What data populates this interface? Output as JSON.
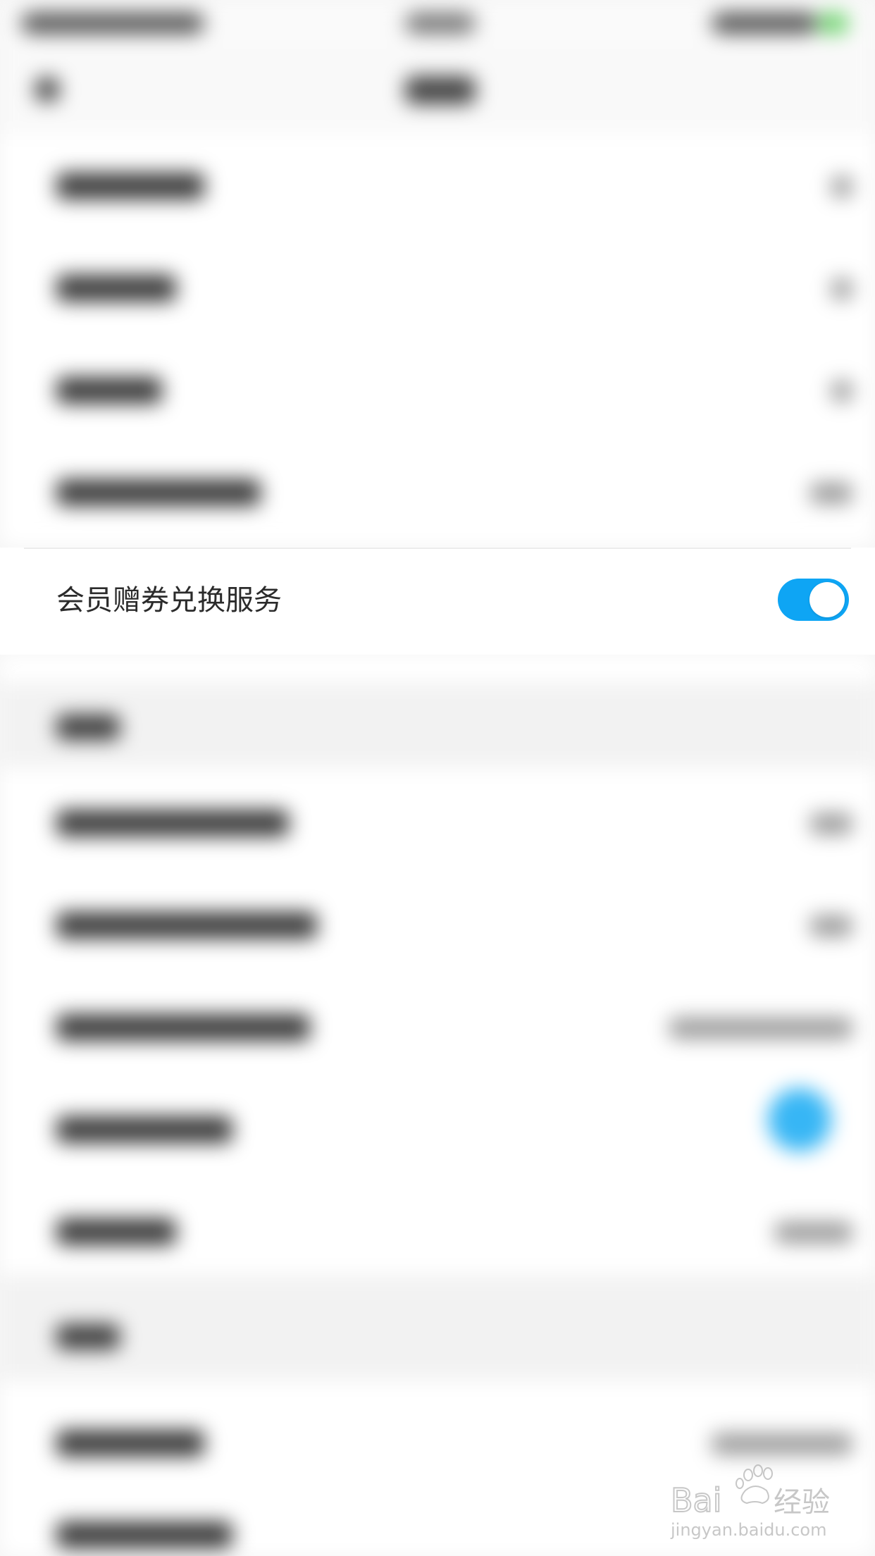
{
  "settings_row": {
    "label": "会员赠券兑换服务",
    "toggle_on": true
  },
  "colors": {
    "accent": "#0ea5f4",
    "row_background": "#ffffff",
    "page_background": "#f5f5f5"
  },
  "watermark": {
    "brand": "Bai du 经验",
    "url": "jingyan.baidu.com"
  }
}
